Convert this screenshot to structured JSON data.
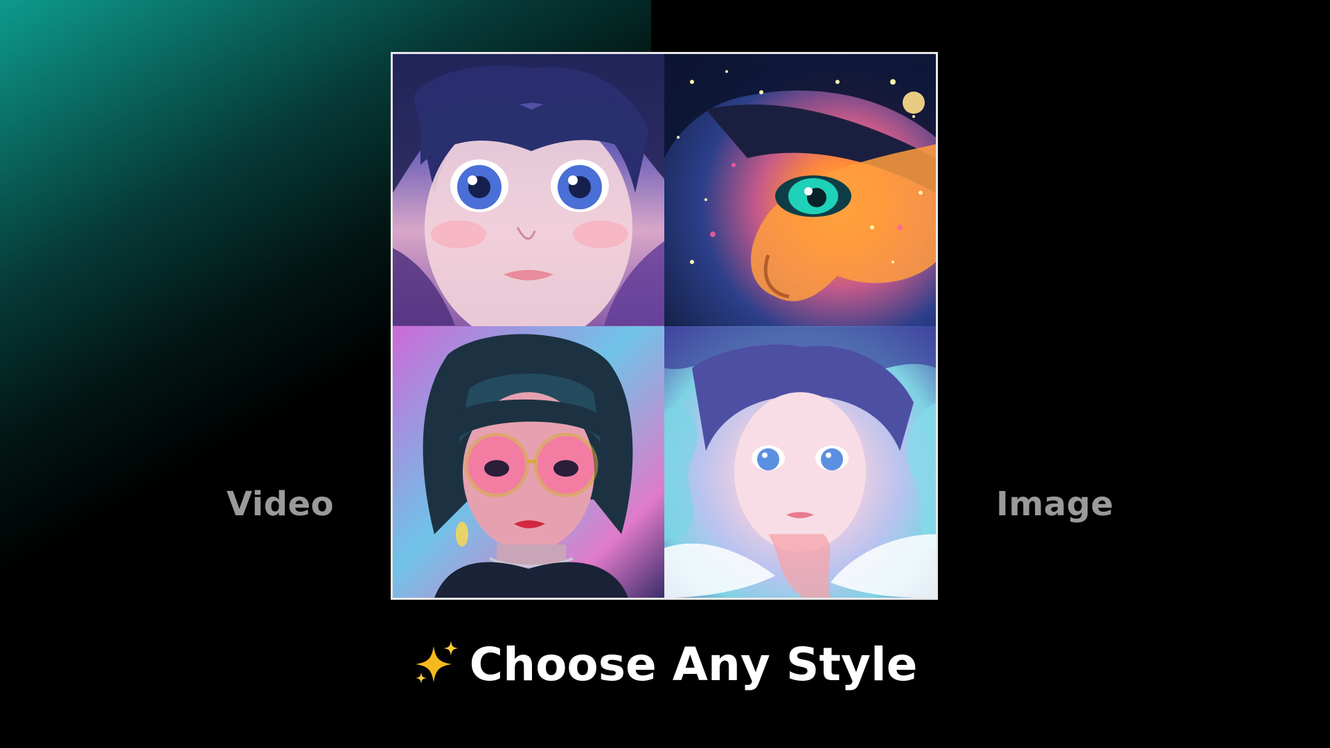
{
  "labels": {
    "left": "Video",
    "right": "Image"
  },
  "caption": {
    "text": "Choose Any Style",
    "icon": "sparkles-icon"
  },
  "gallery": {
    "tiles": [
      {
        "icon": "anime-portrait-blue-eyes"
      },
      {
        "icon": "anime-profile-cosmic-glow"
      },
      {
        "icon": "anime-girl-pink-glasses"
      },
      {
        "icon": "anime-portrait-pastel-smoke"
      }
    ]
  },
  "colors": {
    "background": "#000000",
    "glow": "#0e9a8c",
    "frame_border": "#e8e8e8",
    "side_label": "#9a9a9a",
    "caption": "#ffffff",
    "sparkle": "#f5b91d"
  }
}
